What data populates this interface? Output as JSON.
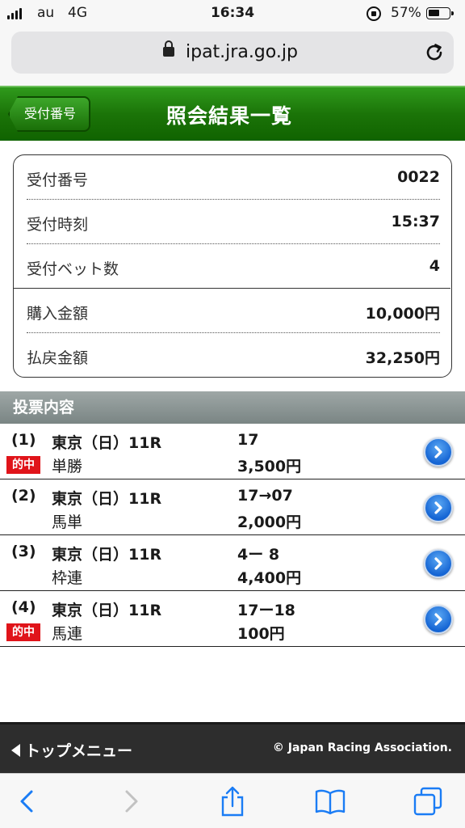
{
  "status_bar": {
    "carrier": "au",
    "network": "4G",
    "time": "16:34",
    "battery_text": "57%",
    "battery_level": 0.57
  },
  "browser": {
    "url": "ipat.jra.go.jp"
  },
  "header": {
    "back_label": "受付番号",
    "title": "照会結果一覧"
  },
  "summary": {
    "rows": [
      {
        "label": "受付番号",
        "value": "0022"
      },
      {
        "label": "受付時刻",
        "value": "15:37"
      },
      {
        "label": "受付ベット数",
        "value": "4"
      },
      {
        "label": "購入金額",
        "value": "10,000円"
      },
      {
        "label": "払戻金額",
        "value": "32,250円"
      }
    ]
  },
  "bets_section": {
    "title": "投票内容",
    "hit_label": "的中",
    "items": [
      {
        "num": "(1)",
        "race": "東京（日）11R",
        "combo": "17",
        "type": "単勝",
        "amount": "3,500円",
        "hit": true
      },
      {
        "num": "(2)",
        "race": "東京（日）11R",
        "combo": "17→07",
        "type": "馬単",
        "amount": "2,000円",
        "hit": false
      },
      {
        "num": "(3)",
        "race": "東京（日）11R",
        "combo": "4ー 8",
        "type": "枠連",
        "amount": "4,400円",
        "hit": false
      },
      {
        "num": "(4)",
        "race": "東京（日）11R",
        "combo": "17ー18",
        "type": "馬連",
        "amount": "100円",
        "hit": true
      }
    ]
  },
  "footer": {
    "top_menu": "トップメニュー",
    "copyright": "© Japan Racing Association."
  },
  "colors": {
    "header_green": "#1b7408",
    "hit_red": "#e0141a",
    "section_gray": "#8a9493",
    "detail_blue": "#1565d4",
    "ios_blue": "#1a7cf5"
  }
}
